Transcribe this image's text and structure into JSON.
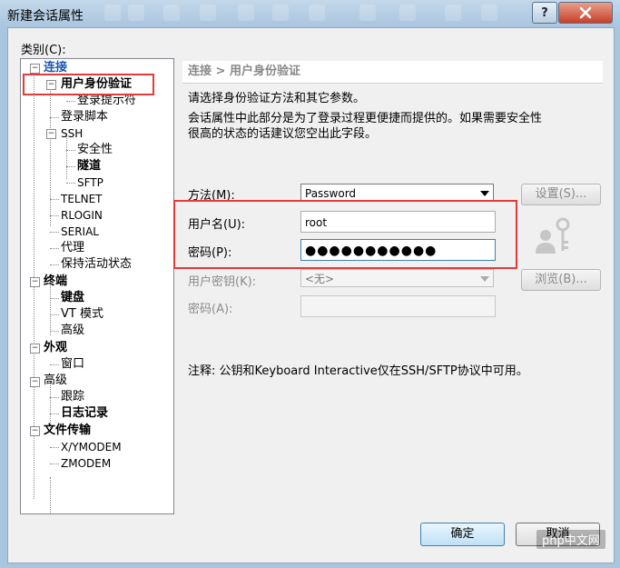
{
  "window": {
    "title": "新建会话属性",
    "help_label": "?"
  },
  "category_label": "类别(C):",
  "tree": {
    "connection": "连接",
    "auth": "用户身份验证",
    "login_prompt": "登录提示符",
    "login_script": "登录脚本",
    "ssh": "SSH",
    "security": "安全性",
    "tunnel": "隧道",
    "sftp": "SFTP",
    "telnet": "TELNET",
    "rlogin": "RLOGIN",
    "serial": "SERIAL",
    "proxy": "代理",
    "keepalive": "保持活动状态",
    "terminal": "终端",
    "keyboard": "键盘",
    "vt_mode": "VT 模式",
    "term_advanced": "高级",
    "appearance": "外观",
    "window": "窗口",
    "advanced": "高级",
    "trace": "跟踪",
    "log": "日志记录",
    "file_transfer": "文件传输",
    "xymodem": "X/YMODEM",
    "zmodem": "ZMODEM"
  },
  "panel": {
    "breadcrumb": "连接 > 用户身份验证",
    "desc1": "请选择身份验证方法和其它参数。",
    "desc2": "会话属性中此部分是为了登录过程更便捷而提供的。如果需要安全性",
    "desc3": "很高的状态的话建议您空出此字段。",
    "method_label": "方法(M):",
    "method_value": "Password",
    "settings_button": "设置(S)...",
    "username_label": "用户名(U):",
    "username_value": "root",
    "password_label": "密码(P):",
    "password_value": "●●●●●●●●●●●",
    "user_key_label": "用户密钥(K):",
    "user_key_value": "<无>",
    "browse_button": "浏览(B)...",
    "passphrase_label": "密码(A):",
    "note": "注释: 公钥和Keyboard Interactive仅在SSH/SFTP协议中可用。"
  },
  "buttons": {
    "ok": "确定",
    "cancel": "取消"
  },
  "watermark": "php中文网",
  "colors": {
    "highlight": "#e33b3b",
    "link_blue": "#1a55b3"
  }
}
